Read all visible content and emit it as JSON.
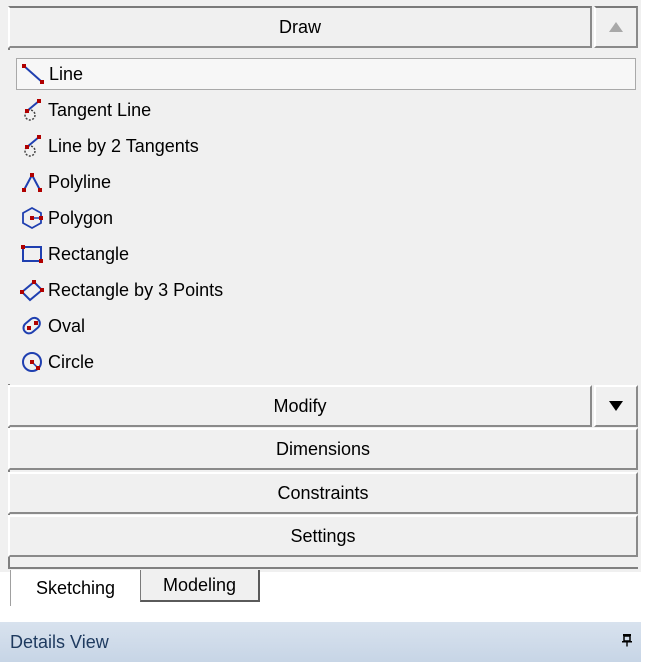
{
  "toolbox": {
    "draw": {
      "label": "Draw"
    },
    "items": [
      {
        "label": "Line",
        "icon": "line-icon"
      },
      {
        "label": "Tangent Line",
        "icon": "tangent-line-icon"
      },
      {
        "label": "Line by 2 Tangents",
        "icon": "line-by-2-tangents-icon"
      },
      {
        "label": "Polyline",
        "icon": "polyline-icon"
      },
      {
        "label": "Polygon",
        "icon": "polygon-icon"
      },
      {
        "label": "Rectangle",
        "icon": "rectangle-icon"
      },
      {
        "label": "Rectangle by 3 Points",
        "icon": "rectangle-3-points-icon"
      },
      {
        "label": "Oval",
        "icon": "oval-icon"
      },
      {
        "label": "Circle",
        "icon": "circle-icon"
      }
    ],
    "modify": {
      "label": "Modify"
    },
    "dimensions": {
      "label": "Dimensions"
    },
    "constraints": {
      "label": "Constraints"
    },
    "settings": {
      "label": "Settings"
    }
  },
  "tabs": [
    {
      "label": "Sketching",
      "active": true
    },
    {
      "label": "Modeling",
      "active": false
    }
  ],
  "details": {
    "title": "Details View"
  },
  "colors": {
    "icon_red": "#b00000",
    "icon_blue": "#1f3fb0",
    "details_text": "#1e3a5f"
  }
}
